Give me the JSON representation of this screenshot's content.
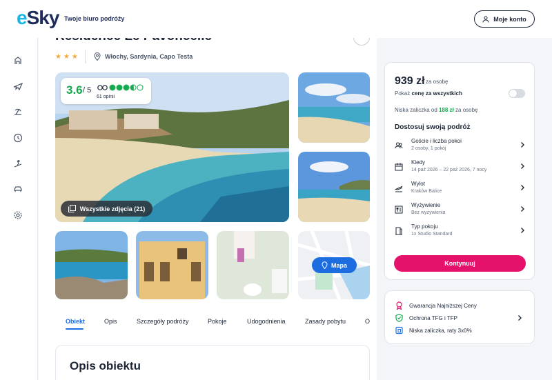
{
  "header": {
    "logo": "eSky",
    "tagline": "Twoje biuro podróży",
    "account_label": "Moje konto",
    "colors": {
      "brand": "#1f2b5b",
      "logo_accent": "#18b5e8"
    }
  },
  "sidebar": {
    "items": [
      {
        "icon": "hotel-icon"
      },
      {
        "icon": "plane-icon"
      },
      {
        "icon": "beach-icon"
      },
      {
        "icon": "clock-icon"
      },
      {
        "icon": "ski-icon"
      },
      {
        "icon": "car-icon"
      },
      {
        "icon": "settings-icon"
      }
    ]
  },
  "hotel": {
    "title": "Residence Le Pavoncelle",
    "stars": "★★★",
    "location": "Włochy, Sardynia, Capo Testa"
  },
  "rating": {
    "score": "3.6",
    "out_of": "/ 5",
    "count": "61 opinii",
    "bubbles_fraction": 0.72
  },
  "gallery": {
    "all_photos_label": "Wszystkie zdjęcia (21)",
    "map_label": "Mapa"
  },
  "tabs": [
    {
      "label": "Obiekt",
      "active": true
    },
    {
      "label": "Opis"
    },
    {
      "label": "Szczegóły podróży"
    },
    {
      "label": "Pokoje"
    },
    {
      "label": "Udogodnienia"
    },
    {
      "label": "Zasady pobytu"
    },
    {
      "label": "Op"
    }
  ],
  "section": {
    "title": "Opis obiektu"
  },
  "booking": {
    "price": "939 zł",
    "price_sub": "za osobę",
    "toggle_prefix": "Pokaż ",
    "toggle_bold": "cenę za wszystkich",
    "deposit_prefix": "Niska zaliczka od ",
    "deposit_amount": "188 zł",
    "deposit_suffix": " za osobę",
    "customize_title": "Dostosuj swoją podróż",
    "options": [
      {
        "title": "Goście i liczba pokoi",
        "sub": "2 osoby, 1 pokój",
        "icon": "guests-icon"
      },
      {
        "title": "Kiedy",
        "sub": "14 paź 2026 – 22 paź 2026, 7 nocy",
        "icon": "calendar-icon"
      },
      {
        "title": "Wylot",
        "sub": "Kraków Balice",
        "icon": "departure-icon"
      },
      {
        "title": "Wyżywienie",
        "sub": "Bez wyżywienia",
        "icon": "meal-icon"
      },
      {
        "title": "Typ pokoju",
        "sub": "1x Studio Standard",
        "icon": "room-icon"
      }
    ],
    "continue_label": "Kontynuuj",
    "colors": {
      "cta": "#e5126b",
      "positive": "#15a84e"
    }
  },
  "trust": {
    "items": [
      {
        "label": "Gwarancja Najniższej Ceny",
        "icon": "award-icon"
      },
      {
        "label": "Ochrona TFG i TFP",
        "icon": "shield-icon"
      },
      {
        "label": "Niska zaliczka, raty 3x0%",
        "icon": "card-icon"
      }
    ]
  }
}
